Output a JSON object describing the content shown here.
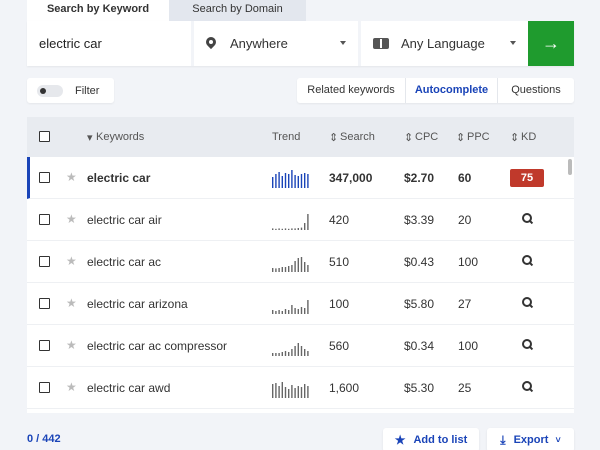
{
  "tabs": {
    "keyword": "Search by Keyword",
    "domain": "Search by Domain"
  },
  "search": {
    "keyword": "electric car",
    "location": "Anywhere",
    "language": "Any Language",
    "go_icon": "arrow-right"
  },
  "filter": {
    "label": "Filter"
  },
  "view_tabs": {
    "related": "Related keywords",
    "autocomplete": "Autocomplete",
    "questions": "Questions"
  },
  "columns": {
    "keywords": "Keywords",
    "trend": "Trend",
    "search": "Search",
    "cpc": "CPC",
    "ppc": "PPC",
    "kd": "KD"
  },
  "rows": [
    {
      "keyword": "electric car",
      "search": "347,000",
      "cpc": "$2.70",
      "ppc": "60",
      "kd": "75",
      "trend": [
        0.55,
        0.7,
        0.8,
        0.6,
        0.75,
        0.7,
        0.9,
        0.65,
        0.6,
        0.7,
        0.75,
        0.7
      ]
    },
    {
      "keyword": "electric car air",
      "search": "420",
      "cpc": "$3.39",
      "ppc": "20",
      "kd": "",
      "trend": [
        0.08,
        0.06,
        0.08,
        0.06,
        0.08,
        0.06,
        0.08,
        0.08,
        0.1,
        0.12,
        0.35,
        0.8
      ]
    },
    {
      "keyword": "electric car ac",
      "search": "510",
      "cpc": "$0.43",
      "ppc": "100",
      "kd": "",
      "trend": [
        0.2,
        0.18,
        0.2,
        0.25,
        0.25,
        0.3,
        0.35,
        0.55,
        0.7,
        0.75,
        0.5,
        0.35
      ]
    },
    {
      "keyword": "electric car arizona",
      "search": "100",
      "cpc": "$5.80",
      "ppc": "27",
      "kd": "",
      "trend": [
        0.2,
        0.15,
        0.2,
        0.15,
        0.25,
        0.2,
        0.45,
        0.3,
        0.25,
        0.35,
        0.3,
        0.7
      ]
    },
    {
      "keyword": "electric car ac compressor",
      "search": "560",
      "cpc": "$0.34",
      "ppc": "100",
      "kd": "",
      "trend": [
        0.15,
        0.15,
        0.15,
        0.2,
        0.25,
        0.2,
        0.35,
        0.5,
        0.65,
        0.5,
        0.35,
        0.25
      ]
    },
    {
      "keyword": "electric car awd",
      "search": "1,600",
      "cpc": "$5.30",
      "ppc": "25",
      "kd": "",
      "trend": [
        0.7,
        0.75,
        0.6,
        0.8,
        0.55,
        0.45,
        0.65,
        0.5,
        0.6,
        0.55,
        0.7,
        0.6
      ]
    }
  ],
  "footer": {
    "count": "0 / 442",
    "add_to_list": "Add to list",
    "export": "Export"
  },
  "colors": {
    "accent": "#1a44b8",
    "go": "#1f9b2e",
    "kd_badge": "#c0392b"
  }
}
